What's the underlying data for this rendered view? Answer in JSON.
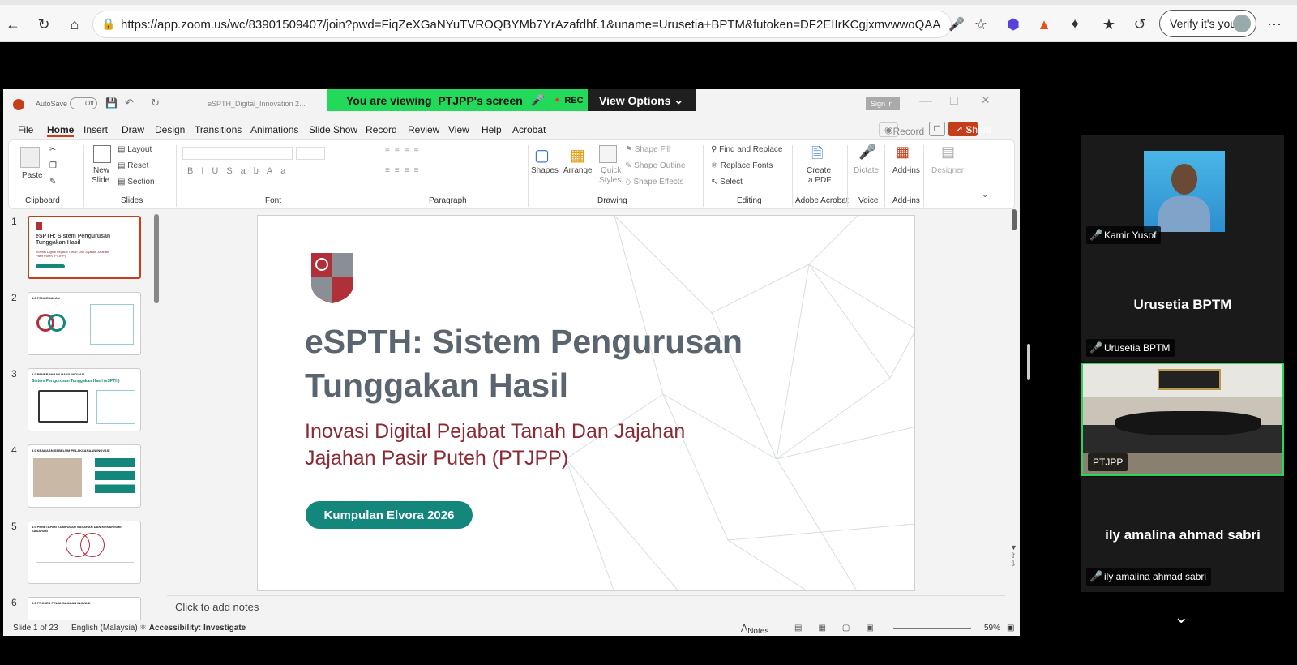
{
  "browser": {
    "url": "https://app.zoom.us/wc/83901509407/join?pwd=FiqZeXGaNYuTVROQBYMb7YrAzafdhf.1&uname=Urusetia+BPTM&futoken=DF2EIIrKCgjxmvwwoQAA...",
    "verify_label": "Verify it's you"
  },
  "share_banner": {
    "viewing_prefix": "You are viewing",
    "viewing_name": "PTJPP's screen",
    "rec_label": "REC",
    "view_options": "View Options"
  },
  "ppt": {
    "autosave": "AutoSave",
    "autosave_state": "Off",
    "filename": "eSPTH_Digital_Innovation 2...",
    "sign_in": "Sign in",
    "menu": [
      "File",
      "Home",
      "Insert",
      "Draw",
      "Design",
      "Transitions",
      "Animations",
      "Slide Show",
      "Record",
      "Review",
      "View",
      "Help",
      "Acrobat"
    ],
    "record_btn": "Record",
    "share_btn": "Share",
    "ribbon": {
      "paste": "Paste",
      "clipboard": "Clipboard",
      "new_slide": "New",
      "new_slide2": "Slide",
      "layout": "Layout",
      "reset": "Reset",
      "section": "Section",
      "slides": "Slides",
      "font": "Font",
      "paragraph": "Paragraph",
      "shapes": "Shapes",
      "arrange": "Arrange",
      "quick_styles": "Quick",
      "quick_styles2": "Styles",
      "shape_fill": "Shape Fill",
      "shape_outline": "Shape Outline",
      "shape_effects": "Shape Effects",
      "drawing": "Drawing",
      "find_replace": "Find and Replace",
      "replace_fonts": "Replace Fonts",
      "select": "Select",
      "editing": "Editing",
      "create_pdf": "Create",
      "create_pdf2": "a PDF",
      "adobe_acrobat": "Adobe Acrobat",
      "dictate": "Dictate",
      "voice": "Voice",
      "add_ins": "Add-ins",
      "add_ins_group": "Add-ins",
      "designer": "Designer"
    },
    "thumbnails": [
      {
        "num": "1",
        "title": "eSPTH: Sistem Pengurusan Tunggakan Hasil",
        "sub": "Inovasi Digital Pejabat Tanah Dan Jajahan Jajahan Pasir Puteh (PTJPP)"
      },
      {
        "num": "2",
        "title": "1.0 PENGENALAN"
      },
      {
        "num": "3",
        "title": "2.0 PENERANGAN HASIL INOVASI",
        "sub": "Sistem Pengurusan Tunggakan Hasil (eSPTH)"
      },
      {
        "num": "4",
        "title": "3.0 KEADAAN SEBELUM PELAKSANAAN INOVASI"
      },
      {
        "num": "5",
        "title": "4.0 PENETAPAN KUMPULAN SASARAN DAN MEKANISME SASARAN"
      },
      {
        "num": "6",
        "title": "5.0 PROSES PELAKSANAAN INOVASI"
      }
    ],
    "slide": {
      "title_line1": "eSPTH: Sistem Pengurusan",
      "title_line2": "Tunggakan Hasil",
      "subtitle_line1": "Inovasi Digital Pejabat Tanah Dan Jajahan",
      "subtitle_line2": "Jajahan Pasir Puteh (PTJPP)",
      "badge": "Kumpulan Elvora 2026"
    },
    "notes_placeholder": "Click to add notes",
    "status": {
      "slide_count": "Slide 1 of 23",
      "language": "English (Malaysia)",
      "accessibility": "Accessibility: Investigate",
      "notes": "Notes",
      "zoom": "59%"
    }
  },
  "participants": [
    {
      "name": "Kamir Yusof",
      "has_video": true
    },
    {
      "name": "Urusetia BPTM",
      "big_name": "Urusetia BPTM",
      "has_video": false
    },
    {
      "name": "PTJPP",
      "has_video": true,
      "active": true
    },
    {
      "name": "ily amalina ahmad sabri",
      "big_name": "ily amalina ahmad sabri",
      "has_video": false
    }
  ],
  "colors": {
    "zoom_green": "#23d959",
    "ppt_red": "#c43e1c",
    "slide_title": "#5a6570",
    "slide_subtitle": "#8a2a35",
    "badge_teal": "#14877d"
  }
}
